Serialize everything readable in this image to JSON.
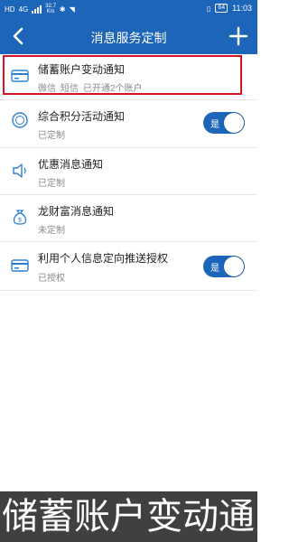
{
  "status_bar": {
    "sim": "HD",
    "network": "4G",
    "speed_value": "32.7",
    "speed_unit": "K/s",
    "battery": "64",
    "time": "11:03"
  },
  "header": {
    "title": "消息服务定制",
    "back_icon": "chevron-left-icon",
    "add_icon": "plus-icon"
  },
  "items": [
    {
      "title": "储蓄账户变动通知",
      "sub": [
        "微信",
        "短信",
        "已开通2个账户"
      ],
      "icon": "card-icon",
      "highlighted": true
    },
    {
      "title": "综合积分活动通知",
      "sub": [
        "已定制"
      ],
      "icon": "points-icon",
      "toggle": {
        "label": "是",
        "on": true
      }
    },
    {
      "title": "优惠消息通知",
      "sub": [
        "已定制"
      ],
      "icon": "speaker-icon"
    },
    {
      "title": "龙财富消息通知",
      "sub": [
        "未定制"
      ],
      "icon": "money-bag-icon"
    },
    {
      "title": "利用个人信息定向推送授权",
      "sub": [
        "已授权"
      ],
      "icon": "card-icon",
      "toggle": {
        "label": "是",
        "on": true
      }
    }
  ],
  "caption": "储蓄账户变动通",
  "colors": {
    "brand": "#1c65b8",
    "highlight": "#d4141f"
  }
}
